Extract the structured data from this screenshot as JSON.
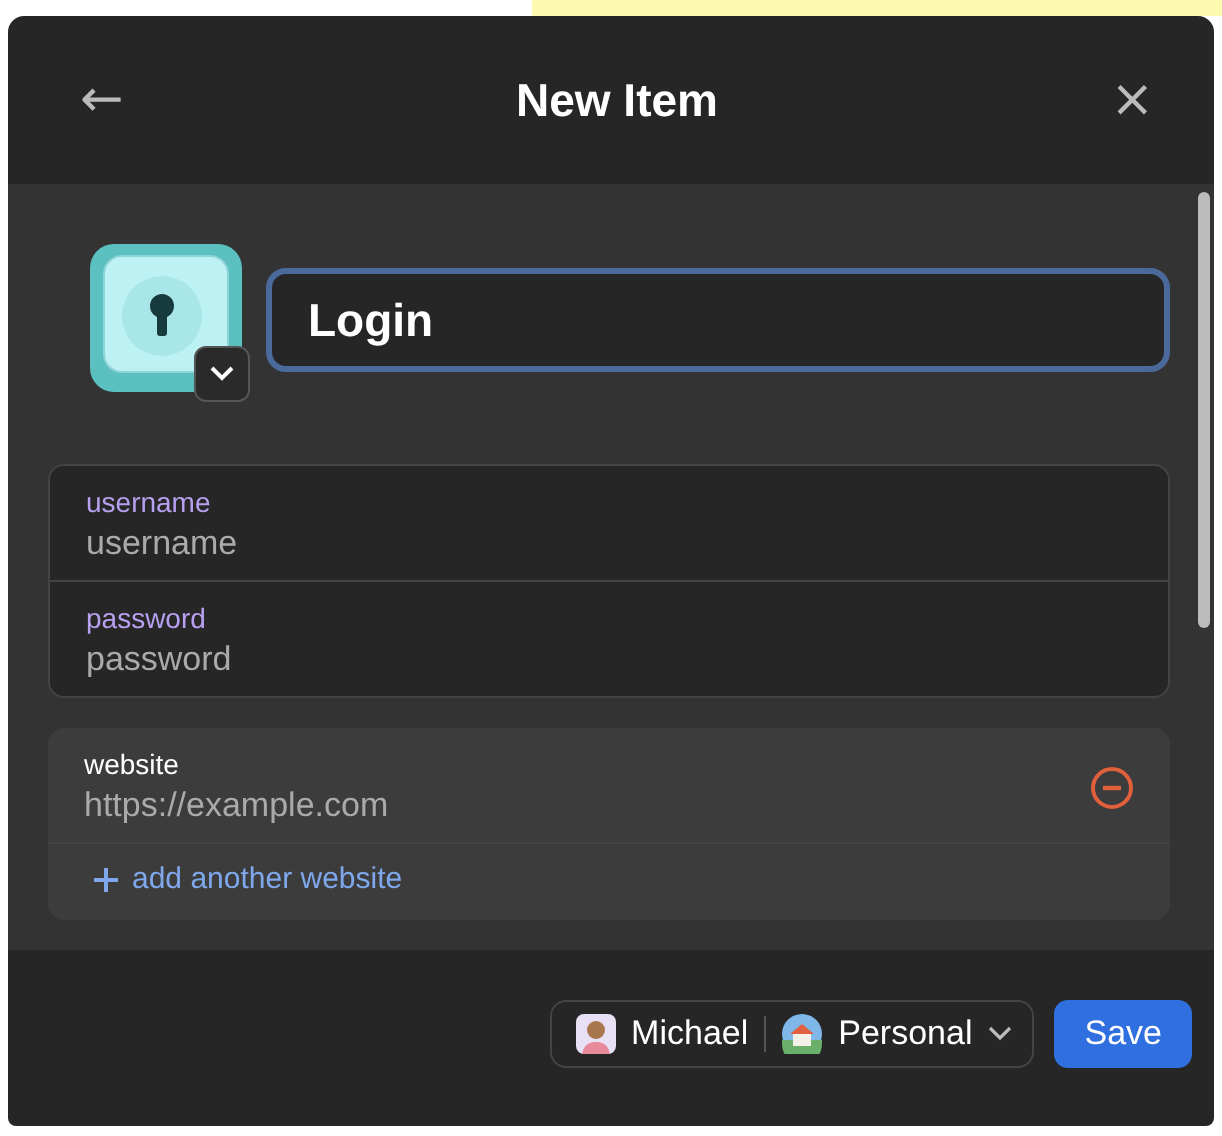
{
  "header": {
    "back": "←",
    "title": "New Item",
    "close": "×"
  },
  "item": {
    "name": "Login"
  },
  "fields": [
    {
      "label": "username",
      "placeholder": "username"
    },
    {
      "label": "password",
      "placeholder": "password"
    }
  ],
  "website": {
    "label": "website",
    "placeholder": "https://example.com",
    "add_label": "add another website"
  },
  "footer": {
    "owner": "Michael",
    "vault": "Personal",
    "save": "Save"
  }
}
